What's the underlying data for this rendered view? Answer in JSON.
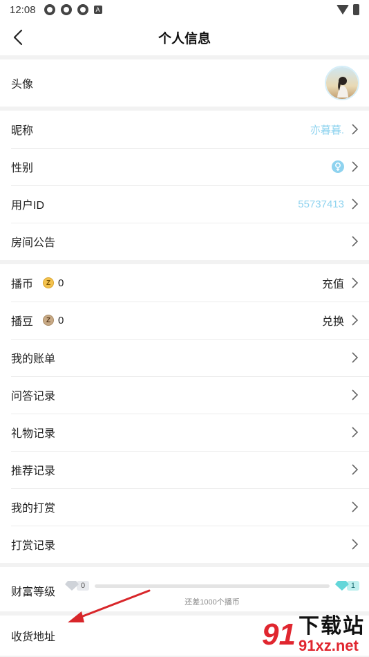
{
  "status_bar": {
    "time": "12:08",
    "notif_letter": "A"
  },
  "header": {
    "title": "个人信息"
  },
  "profile": {
    "avatar_label": "头像",
    "nickname_label": "昵称",
    "nickname_value": "亦暮暮.",
    "gender_label": "性别",
    "user_id_label": "用户ID",
    "user_id_value": "55737413",
    "room_notice_label": "房间公告"
  },
  "wallet": {
    "coins_label": "播币",
    "coins_value": "0",
    "coins_icon": "Z",
    "recharge_label": "充值",
    "beans_label": "播豆",
    "beans_value": "0",
    "beans_icon": "Z",
    "exchange_label": "兑换"
  },
  "records": {
    "items": [
      {
        "label": "我的账单"
      },
      {
        "label": "问答记录"
      },
      {
        "label": "礼物记录"
      },
      {
        "label": "推荐记录"
      },
      {
        "label": "我的打赏"
      },
      {
        "label": "打赏记录"
      }
    ]
  },
  "wealth": {
    "label": "财富等级",
    "current_level": "0",
    "next_level": "1",
    "hint": "还差1000个播币",
    "progress": 0
  },
  "address": {
    "label": "收货地址"
  },
  "watermark": {
    "cn": "下载站",
    "en": "91xz.net",
    "logo": "91"
  },
  "colors": {
    "accent": "#8fd3ef",
    "annotation_red": "#d8262a"
  }
}
